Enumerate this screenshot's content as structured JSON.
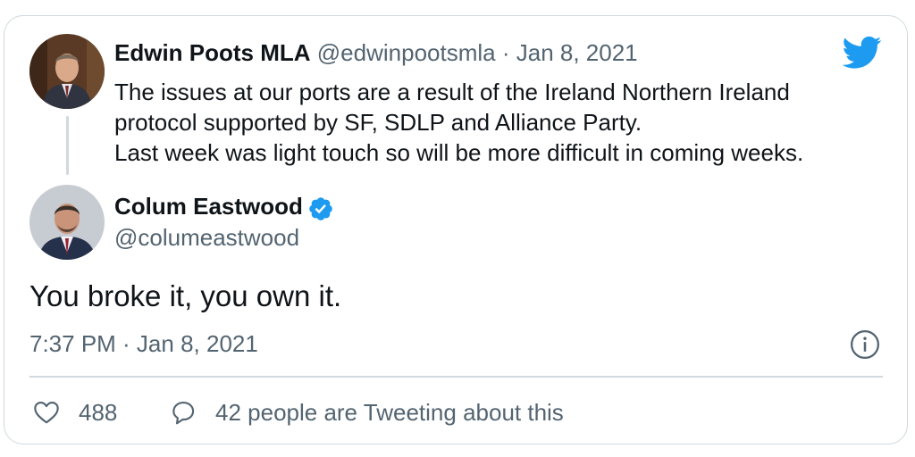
{
  "parent_tweet": {
    "author_name": "Edwin Poots MLA",
    "handle": "@edwinpootsmla",
    "separator": "·",
    "date": "Jan 8, 2021",
    "lines": [
      "The issues at our ports are a result of the Ireland Northern Ireland",
      "protocol supported by SF, SDLP and Alliance Party.",
      "Last week was light touch so will be more difficult in coming weeks."
    ],
    "avatar_icon": "profile-photo"
  },
  "main_tweet": {
    "author_name": "Colum Eastwood",
    "handle": "@columeastwood",
    "verified_icon": "verified-badge-icon",
    "text": "You broke it, you own it.",
    "timestamp": "7:37 PM · Jan 8, 2021",
    "avatar_icon": "profile-photo"
  },
  "actions": {
    "like_count": "488",
    "conversation_text": "42 people are Tweeting about this",
    "like_icon": "heart-icon",
    "reply_icon": "speech-bubble-icon",
    "info_icon": "info-icon"
  },
  "colors": {
    "twitter_blue": "#1d9bf0",
    "muted_text": "#536471",
    "border": "#cfd9de"
  },
  "brand_icon": "twitter-bird-icon"
}
